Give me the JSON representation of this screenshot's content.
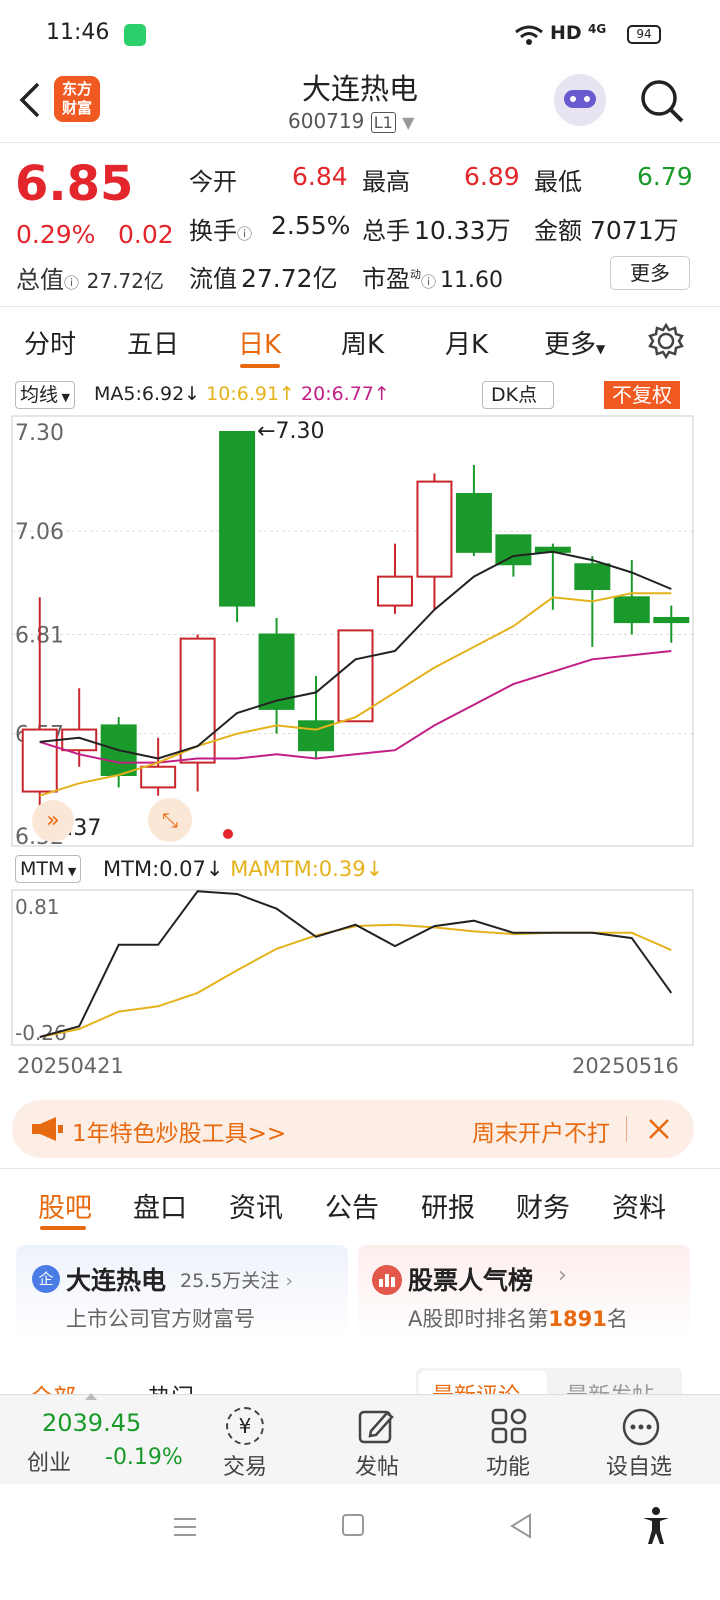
{
  "status": {
    "time": "11:46",
    "network": "HD",
    "signal": "4G",
    "battery": "94"
  },
  "header": {
    "logo_line1": "东方",
    "logo_line2": "财富",
    "title": "大连热电",
    "code": "600719",
    "code_badge": "L1"
  },
  "quote": {
    "price": "6.85",
    "pct": "0.29%",
    "change": "0.02",
    "open_label": "今开",
    "open": "6.84",
    "high_label": "最高",
    "high": "6.89",
    "low_label": "最低",
    "low": "6.79",
    "turnover_label": "换手",
    "turnover": "2.55%",
    "volume_label": "总手",
    "volume": "10.33万",
    "amount_label": "金额",
    "amount": "7071万",
    "mcap_label": "总值",
    "mcap": "27.72亿",
    "float_label": "流值",
    "float": "27.72亿",
    "pe_label": "市盈",
    "pe_sup": "动",
    "pe": "11.60",
    "more": "更多"
  },
  "tabs": {
    "items": [
      "分时",
      "五日",
      "日K",
      "周K",
      "月K",
      "更多"
    ],
    "active": 2
  },
  "chart_bar": {
    "ma_select": "均线",
    "ma5": "MA5:6.92↓",
    "ma10": "10:6.91↑",
    "ma20": "20:6.77↑",
    "dk": "DK点",
    "restore": "不复权"
  },
  "chart_data": {
    "type": "candlestick",
    "y_ticks": [
      "7.30",
      "7.06",
      "6.81",
      "6.57",
      "6.32"
    ],
    "ylim": [
      6.32,
      7.3
    ],
    "high_marker": "7.30",
    "low_marker": "6.37",
    "dates": [
      "20250421",
      "20250516"
    ],
    "candles": [
      {
        "o": 6.43,
        "c": 6.58,
        "h": 6.9,
        "l": 6.37
      },
      {
        "o": 6.53,
        "c": 6.58,
        "h": 6.68,
        "l": 6.49
      },
      {
        "o": 6.59,
        "c": 6.47,
        "h": 6.61,
        "l": 6.44
      },
      {
        "o": 6.44,
        "c": 6.49,
        "h": 6.56,
        "l": 6.42
      },
      {
        "o": 6.5,
        "c": 6.8,
        "h": 6.81,
        "l": 6.43
      },
      {
        "o": 7.3,
        "c": 6.88,
        "h": 7.3,
        "l": 6.84
      },
      {
        "o": 6.81,
        "c": 6.63,
        "h": 6.85,
        "l": 6.57
      },
      {
        "o": 6.6,
        "c": 6.53,
        "h": 6.71,
        "l": 6.51
      },
      {
        "o": 6.6,
        "c": 6.82,
        "h": 6.82,
        "l": 6.6
      },
      {
        "o": 6.88,
        "c": 6.95,
        "h": 7.03,
        "l": 6.86
      },
      {
        "o": 6.95,
        "c": 7.18,
        "h": 7.2,
        "l": 6.87
      },
      {
        "o": 7.15,
        "c": 7.01,
        "h": 7.22,
        "l": 7.0
      },
      {
        "o": 7.05,
        "c": 6.98,
        "h": 7.05,
        "l": 6.95
      },
      {
        "o": 7.02,
        "c": 7.01,
        "h": 7.03,
        "l": 6.87
      },
      {
        "o": 6.98,
        "c": 6.92,
        "h": 7.0,
        "l": 6.78
      },
      {
        "o": 6.9,
        "c": 6.84,
        "h": 6.99,
        "l": 6.81
      },
      {
        "o": 6.85,
        "c": 6.84,
        "h": 6.88,
        "l": 6.79
      }
    ],
    "ma5": [
      6.55,
      6.56,
      6.53,
      6.51,
      6.54,
      6.62,
      6.65,
      6.67,
      6.75,
      6.77,
      6.87,
      6.95,
      7.0,
      7.01,
      6.99,
      6.96,
      6.92
    ],
    "ma10": [
      6.42,
      6.45,
      6.47,
      6.5,
      6.54,
      6.57,
      6.59,
      6.58,
      6.61,
      6.67,
      6.73,
      6.78,
      6.83,
      6.9,
      6.89,
      6.91,
      6.91
    ],
    "ma20": [
      6.55,
      6.52,
      6.5,
      6.5,
      6.51,
      6.51,
      6.52,
      6.51,
      6.52,
      6.53,
      6.59,
      6.64,
      6.69,
      6.72,
      6.75,
      6.76,
      6.77
    ],
    "mtm_ticks": [
      "0.81",
      "-0.26"
    ],
    "mtm_ylim": [
      -0.26,
      0.81
    ],
    "mtm": [
      -0.26,
      -0.18,
      0.43,
      0.43,
      0.83,
      0.81,
      0.7,
      0.49,
      0.58,
      0.42,
      0.57,
      0.61,
      0.52,
      0.52,
      0.52,
      0.48,
      0.07
    ],
    "mamtm": [
      -0.26,
      -0.2,
      -0.07,
      -0.03,
      0.07,
      0.24,
      0.4,
      0.5,
      0.57,
      0.58,
      0.56,
      0.53,
      0.51,
      0.52,
      0.52,
      0.52,
      0.39
    ]
  },
  "mtm_bar": {
    "select": "MTM",
    "mtm": "MTM:0.07↓",
    "mamtm": "MAMTM:0.39↓"
  },
  "banner": {
    "left": "1年特色炒股工具>>",
    "right": "周末开户不打"
  },
  "sub_tabs": [
    "股吧",
    "盘口",
    "资讯",
    "公告",
    "研报",
    "财务",
    "资料"
  ],
  "cards": {
    "left_badge": "企",
    "left_title": "大连热电",
    "left_follow": "25.5万关注",
    "left_sub": "上市公司官方财富号",
    "right_title": "股票人气榜",
    "right_sub_pre": "A股即时排名第",
    "right_rank": "1891",
    "right_sub_post": "名"
  },
  "partial": {
    "all": "全部",
    "hot": "热门",
    "latest_comment": "最新评论",
    "latest_post": "最新发帖"
  },
  "bottom_nav": {
    "index_value": "2039.45",
    "index_name": "创业",
    "index_pct": "-0.19%",
    "trade": "交易",
    "post": "发帖",
    "func": "功能",
    "watch": "设自选"
  }
}
